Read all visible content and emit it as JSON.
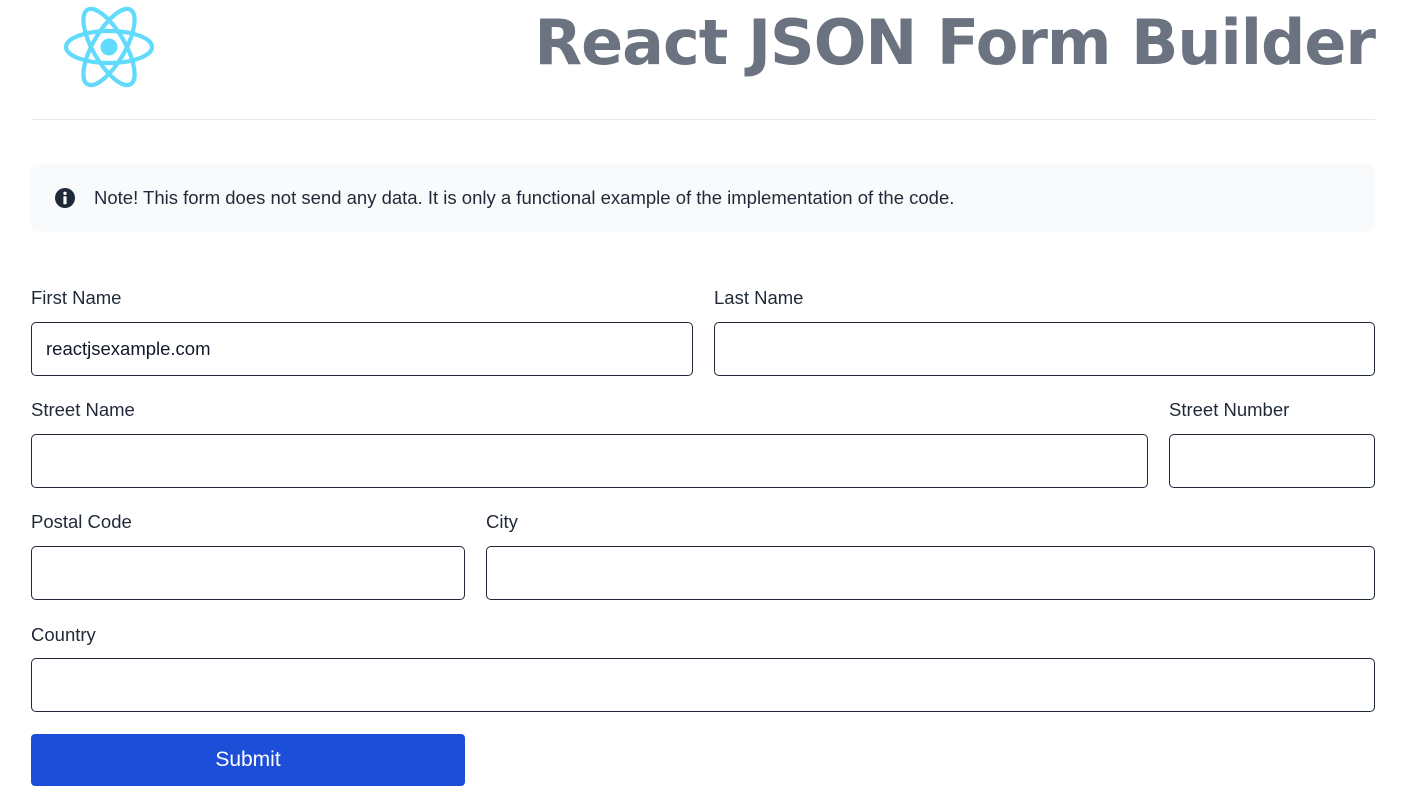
{
  "header": {
    "title": "React JSON Form Builder",
    "logo_icon": "react-atom-icon",
    "logo_color": "#61dafb"
  },
  "note": {
    "icon": "info-circle-icon",
    "text": "Note! This form does not send any data. It is only a functional example of the implementation of the code."
  },
  "form": {
    "first_name": {
      "label": "First Name",
      "value": "reactjsexample.com"
    },
    "last_name": {
      "label": "Last Name",
      "value": ""
    },
    "street_name": {
      "label": "Street Name",
      "value": ""
    },
    "street_number": {
      "label": "Street Number",
      "value": ""
    },
    "postal_code": {
      "label": "Postal Code",
      "value": ""
    },
    "city": {
      "label": "City",
      "value": ""
    },
    "country": {
      "label": "Country",
      "value": ""
    },
    "submit_label": "Submit"
  },
  "colors": {
    "title": "#6b7280",
    "button": "#1d4ed8",
    "note_bg": "#f9fafb"
  }
}
